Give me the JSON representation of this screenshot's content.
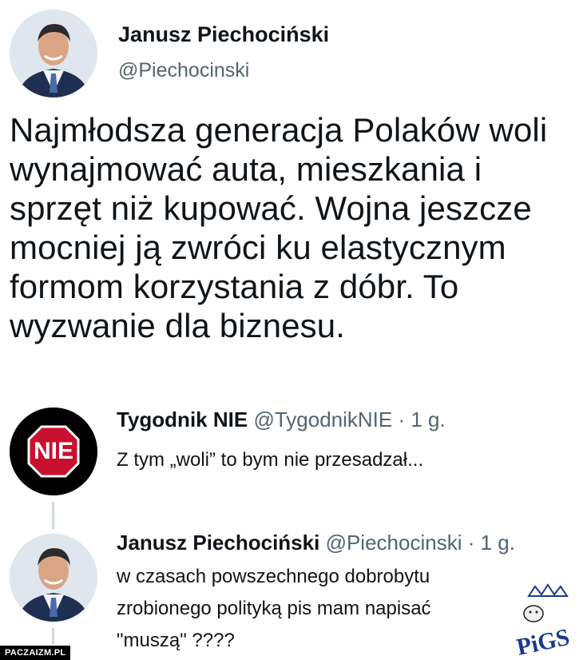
{
  "main_tweet": {
    "author_name": "Janusz Piechociński",
    "author_handle": "@Piechocinski",
    "lines": [
      "Najmłodsza generacja Polaków woli",
      "wynajmować auta, mieszkania i",
      "sprzęt niż kupować. Wojna jeszcze",
      "mocniej ją zwróci ku elastycznym",
      "formom korzystania z dóbr. To",
      "wyzwanie dla biznesu."
    ]
  },
  "reply1": {
    "author_name": "Tygodnik NIE",
    "author_handle": "@TygodnikNIE",
    "time": "· 1 g.",
    "avatar_text": "NIE",
    "text": "Z tym „woli” to bym nie przesadzał..."
  },
  "reply2": {
    "author_name": "Janusz Piechociński",
    "author_handle": "@Piechocinski",
    "time": "· 1 g.",
    "lines": [
      "w czasach powszechnego dobrobytu",
      "zrobionego polityką pis mam napisać",
      "\"muszą\" ????"
    ]
  },
  "watermark": "PACZAIZM.PL",
  "stamp": "PiGS",
  "colors": {
    "stop_sign_red": "#c8102e",
    "handle_gray": "#536471",
    "thread_line": "#cfd9de"
  }
}
